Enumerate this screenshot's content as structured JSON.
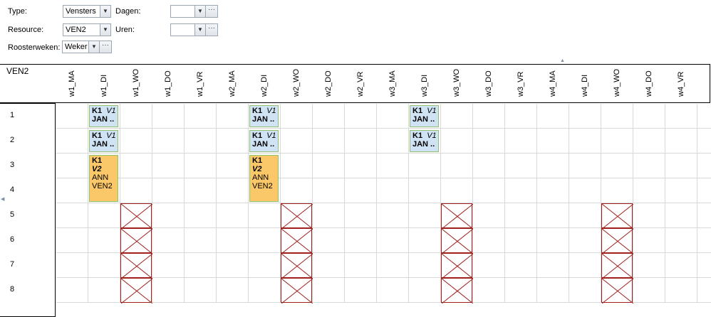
{
  "filters": {
    "type_label": "Type:",
    "type_value": "Vensters",
    "dagen_label": "Dagen:",
    "dagen_value": "",
    "resource_label": "Resource:",
    "resource_value": "VEN2",
    "uren_label": "Uren:",
    "uren_value": "",
    "roosterweken_label": "Roosterweken:",
    "roosterweken_value": "Weker",
    "dropdown_icon": "chevron-down-icon",
    "more_icon": "ellipsis-icon"
  },
  "grid": {
    "title": "VEN2",
    "columns": [
      "w1_MA",
      "w1_DI",
      "w1_WO",
      "w1_DO",
      "w1_VR",
      "w2_MA",
      "w2_DI",
      "w2_WO",
      "w2_DO",
      "w2_VR",
      "w3_MA",
      "w3_DI",
      "w3_WO",
      "w3_DO",
      "w3_VR",
      "w4_MA",
      "w4_DI",
      "w4_WO",
      "w4_DO",
      "w4_VR"
    ],
    "rows": [
      "1",
      "2",
      "3",
      "4",
      "5",
      "6",
      "7",
      "8"
    ],
    "lessons": [
      {
        "col": 1,
        "row": 0,
        "span": 1,
        "color": "blue",
        "lines": [
          "K1",
          "V1",
          "JAN .."
        ]
      },
      {
        "col": 1,
        "row": 1,
        "span": 1,
        "color": "blue",
        "lines": [
          "K1",
          "V1",
          "JAN .."
        ]
      },
      {
        "col": 1,
        "row": 2,
        "span": 2,
        "color": "orange",
        "lines": [
          "K1",
          "V2",
          "ANN",
          "VEN2"
        ]
      },
      {
        "col": 6,
        "row": 0,
        "span": 1,
        "color": "blue",
        "lines": [
          "K1",
          "V1",
          "JAN .."
        ]
      },
      {
        "col": 6,
        "row": 1,
        "span": 1,
        "color": "blue",
        "lines": [
          "K1",
          "V1",
          "JAN .."
        ]
      },
      {
        "col": 6,
        "row": 2,
        "span": 2,
        "color": "orange",
        "lines": [
          "K1",
          "V2",
          "ANN",
          "VEN2"
        ]
      },
      {
        "col": 11,
        "row": 0,
        "span": 1,
        "color": "blue",
        "lines": [
          "K1",
          "V1",
          "JAN .."
        ]
      },
      {
        "col": 11,
        "row": 1,
        "span": 1,
        "color": "blue",
        "lines": [
          "K1",
          "V1",
          "JAN .."
        ]
      }
    ],
    "blocked": [
      {
        "col": 2,
        "rows": [
          4,
          5,
          6,
          7
        ]
      },
      {
        "col": 7,
        "rows": [
          4,
          5,
          6,
          7
        ]
      },
      {
        "col": 12,
        "rows": [
          4,
          5,
          6,
          7
        ]
      },
      {
        "col": 17,
        "rows": [
          4,
          5,
          6,
          7
        ]
      }
    ],
    "colors": {
      "blue": "#cfe3f4",
      "orange": "#fac868",
      "blocked": "#a0201c",
      "border": "#8fc26b"
    }
  }
}
